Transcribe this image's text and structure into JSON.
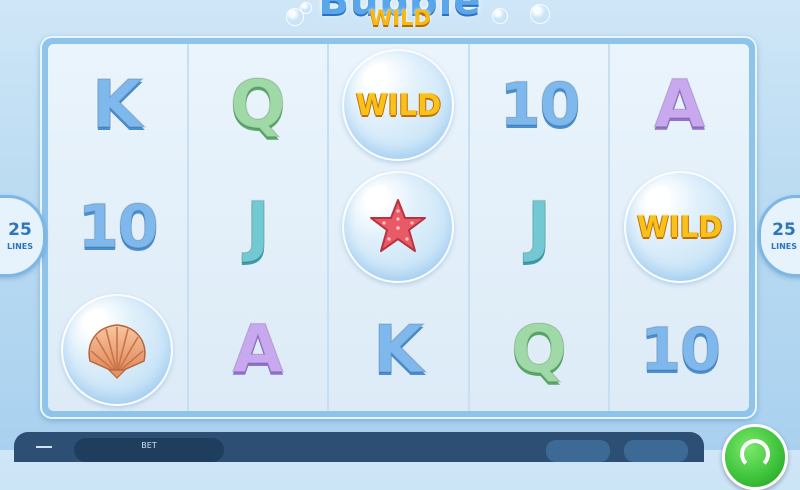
{
  "logo": {
    "title": "Bubble",
    "subtitle": "WILD"
  },
  "reels": [
    [
      "K",
      "10",
      "SHELL"
    ],
    [
      "Q",
      "J",
      "A"
    ],
    [
      "WILD",
      "STARFISH",
      "K"
    ],
    [
      "10",
      "J",
      "Q"
    ],
    [
      "A",
      "WILD",
      "10"
    ]
  ],
  "lines": {
    "count": "25",
    "label": "LINES"
  },
  "bottom_bar": {
    "bet_label": "BET"
  },
  "icons": {
    "shell": "scallop-shell-icon",
    "starfish": "starfish-icon",
    "spin": "spin-icon",
    "menu": "menu-icon"
  },
  "colors": {
    "background": "#bcdcf2",
    "wild_gold": "#f9c21b",
    "spin_green": "#3cc13a",
    "bar_navy": "#2c4f73"
  }
}
